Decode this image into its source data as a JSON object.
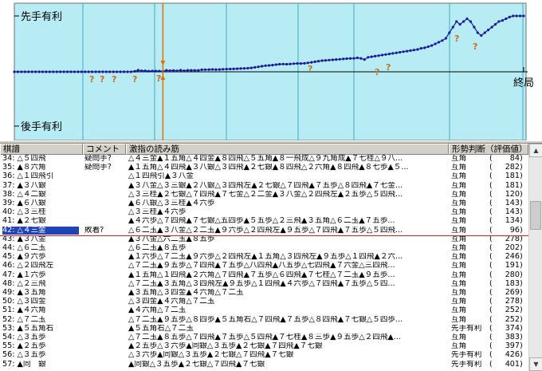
{
  "graph": {
    "label_sente": "先手有利",
    "label_gote": "後手有利",
    "label_end": "終局",
    "colors": {
      "background": "#b8ecf4",
      "line": "#1a1aa0",
      "question": "#c87018",
      "cursor": "#e07000",
      "vline": "#40a8c0"
    }
  },
  "columns": {
    "move": "棋譜",
    "comment": "コメント",
    "line": "激指の読み筋",
    "eval": "形勢判断（評価値）"
  },
  "rows": [
    {
      "move": "34: △５四飛",
      "comment": "疑問手?",
      "line": "△４三金▲１五角△４四金▲８四飛△５五角▲８一飛成△９九角成▲７七桂△９八...",
      "eval": "互角",
      "score": "84"
    },
    {
      "move": "35: ▲８六角",
      "comment": "疑問手?",
      "line": "▲１五角△４四飛▲３八銀△３四飛▲２七銀▲８四飛△２六角▲８四飛▲８七歩▲５...",
      "eval": "互角",
      "score": "282"
    },
    {
      "move": "36: △１四飛引",
      "comment": "",
      "line": "△１四飛引▲３八金",
      "eval": "互角",
      "score": "181"
    },
    {
      "move": "37: ▲３八銀",
      "comment": "",
      "line": "▲３八金△３三銀▲２八銀△３四飛左▲２七銀△７四飛▲７五歩△８四飛▲７七金...",
      "eval": "互角",
      "score": "181"
    },
    {
      "move": "38: △４二銀",
      "comment": "",
      "line": "△３三桂▲２七銀△７四飛▲７七金△２二金▲３八金△２四飛左▲２五歩△５四飛...",
      "eval": "互角",
      "score": "120"
    },
    {
      "move": "39: ▲６八銀",
      "comment": "",
      "line": "▲６八銀△３三桂▲４六歩",
      "eval": "互角",
      "score": "143"
    },
    {
      "move": "40: △３三桂",
      "comment": "",
      "line": "△３三桂▲４六歩",
      "eval": "互角",
      "score": "143"
    },
    {
      "move": "41: ▲２七銀",
      "comment": "",
      "line": "▲４六歩△７四飛▲７七銀△五四歩▲５五歩△２三飛▲３五角△６二玉▲７五歩...",
      "eval": "互角",
      "score": "134"
    },
    {
      "move": "42: △４三金",
      "comment": "敗着?",
      "line": "△６二玉▲３八金△２二玉▲９六歩△２四飛左▲９五歩△７四飛▲７五歩△５四飛...",
      "eval": "互角",
      "score": "96"
    },
    {
      "move": "43: ▲３八金",
      "comment": "",
      "line": "▲３八金△六二玉▲８五歩",
      "eval": "互角",
      "score": "278"
    },
    {
      "move": "44: △６二玉",
      "comment": "",
      "line": "△６二玉▲８五歩",
      "eval": "互角",
      "score": "202"
    },
    {
      "move": "45: ▲９六歩",
      "comment": "",
      "line": "▲１六歩△７二玉▲９六歩△２四飛左▲１五角△３四飛左▲９五歩△１四飛▲２六...",
      "eval": "互角",
      "score": "246"
    },
    {
      "move": "46: △２四飛左",
      "comment": "",
      "line": "△７二玉▲９五歩△７四飛▲７五歩△八四飛▲八五歩△七四飛▲７六金△三四飛...",
      "eval": "互角",
      "score": "191"
    },
    {
      "move": "47: ▲１六歩",
      "comment": "",
      "line": "▲１五角△１四飛▲２六角△７四飛▲７五歩△６四飛▲７七桂△７二玉▲９五歩...",
      "eval": "互角",
      "score": "280"
    },
    {
      "move": "48: △２三飛",
      "comment": "",
      "line": "△７二玉▲３五角△３四飛左▲９五歩△１四飛▲４六歩△７四飛▲７五歩△５四...",
      "eval": "互角",
      "score": "183"
    },
    {
      "move": "49: ▲３五角",
      "comment": "",
      "line": "▲３五角△３四金▲４六角△７二玉",
      "eval": "互角",
      "score": "269"
    },
    {
      "move": "50: △３四金",
      "comment": "",
      "line": "△３四金▲４六角△７二玉",
      "eval": "互角",
      "score": "278"
    },
    {
      "move": "51: ▲４六角",
      "comment": "",
      "line": "▲４六角△７二玉",
      "eval": "互角",
      "score": "252"
    },
    {
      "move": "52: △７二玉",
      "comment": "",
      "line": "△７二玉▲９五歩△８四歩▲５五角右△７四飛▲７五歩△８四飛▲７七銀△５四歩...",
      "eval": "互角",
      "score": "252"
    },
    {
      "move": "53: ▲５五角右",
      "comment": "",
      "line": "▲５五角右△７二玉",
      "eval": "先手有利",
      "score": "374"
    },
    {
      "move": "54: △３五歩",
      "comment": "",
      "line": "△７二玉▲８五歩△７四飛▲７五歩△５四飛▲７七桂▲８三歩▲９五歩△２四飛▲...",
      "eval": "互角",
      "score": "383"
    },
    {
      "move": "55: ▲２五歩",
      "comment": "",
      "line": "▲２五歩△３六歩▲同銀△３五歩▲２七銀▲７四飛▲７七銀",
      "eval": "互角",
      "score": "397"
    },
    {
      "move": "56: △３五歩",
      "comment": "",
      "line": "△３六歩▲同銀△３五歩▲２七銀△７四飛▲７七銀",
      "eval": "先手有利",
      "score": "426"
    },
    {
      "move": "57: ▲同　銀",
      "comment": "",
      "line": "▲同銀△３五歩▲２七銀△７四飛▲７七銀",
      "eval": "先手有利",
      "score": "401"
    }
  ],
  "selected_index": 8,
  "chart_data": {
    "type": "line",
    "title": "",
    "ylabel_top": "先手有利",
    "ylabel_bottom": "後手有利",
    "x_end_label": "終局",
    "cursor_move": 42,
    "values": [
      0,
      0,
      0,
      0,
      0,
      0,
      0,
      0,
      0,
      0,
      0,
      0,
      0,
      0,
      0,
      0,
      0,
      0,
      0,
      0,
      0,
      0,
      0,
      0,
      0,
      0,
      0,
      0,
      0,
      0,
      0,
      0,
      0,
      0,
      84,
      282,
      181,
      181,
      120,
      143,
      143,
      134,
      96,
      278,
      202,
      246,
      191,
      280,
      183,
      269,
      278,
      252,
      252,
      374,
      383,
      397,
      426,
      401,
      420,
      450,
      480,
      500,
      520,
      560,
      590,
      620,
      650,
      700,
      800,
      900,
      1000,
      1100,
      1150,
      1200,
      1280,
      1350,
      1380,
      1360,
      1400,
      1450,
      1500,
      1480,
      1520,
      1600,
      1700,
      1800,
      1900,
      2000,
      2050,
      2100,
      2150,
      2200,
      2250,
      2300,
      2350,
      2400,
      2420,
      2500,
      2400,
      2200,
      2600,
      2700,
      2800,
      2900,
      3000,
      3100,
      3200,
      3300,
      3400,
      3500,
      3600,
      3700,
      3800,
      3900,
      4000,
      4200,
      4300,
      4500,
      4700,
      5000,
      5300,
      5600,
      6000,
      7000,
      8000,
      9000,
      8500,
      9000,
      9500,
      9000,
      8000,
      7000,
      6500,
      7000,
      7500,
      8000,
      8500,
      9000,
      9200,
      9500,
      9800,
      10000,
      10000,
      10000,
      10000
    ]
  }
}
